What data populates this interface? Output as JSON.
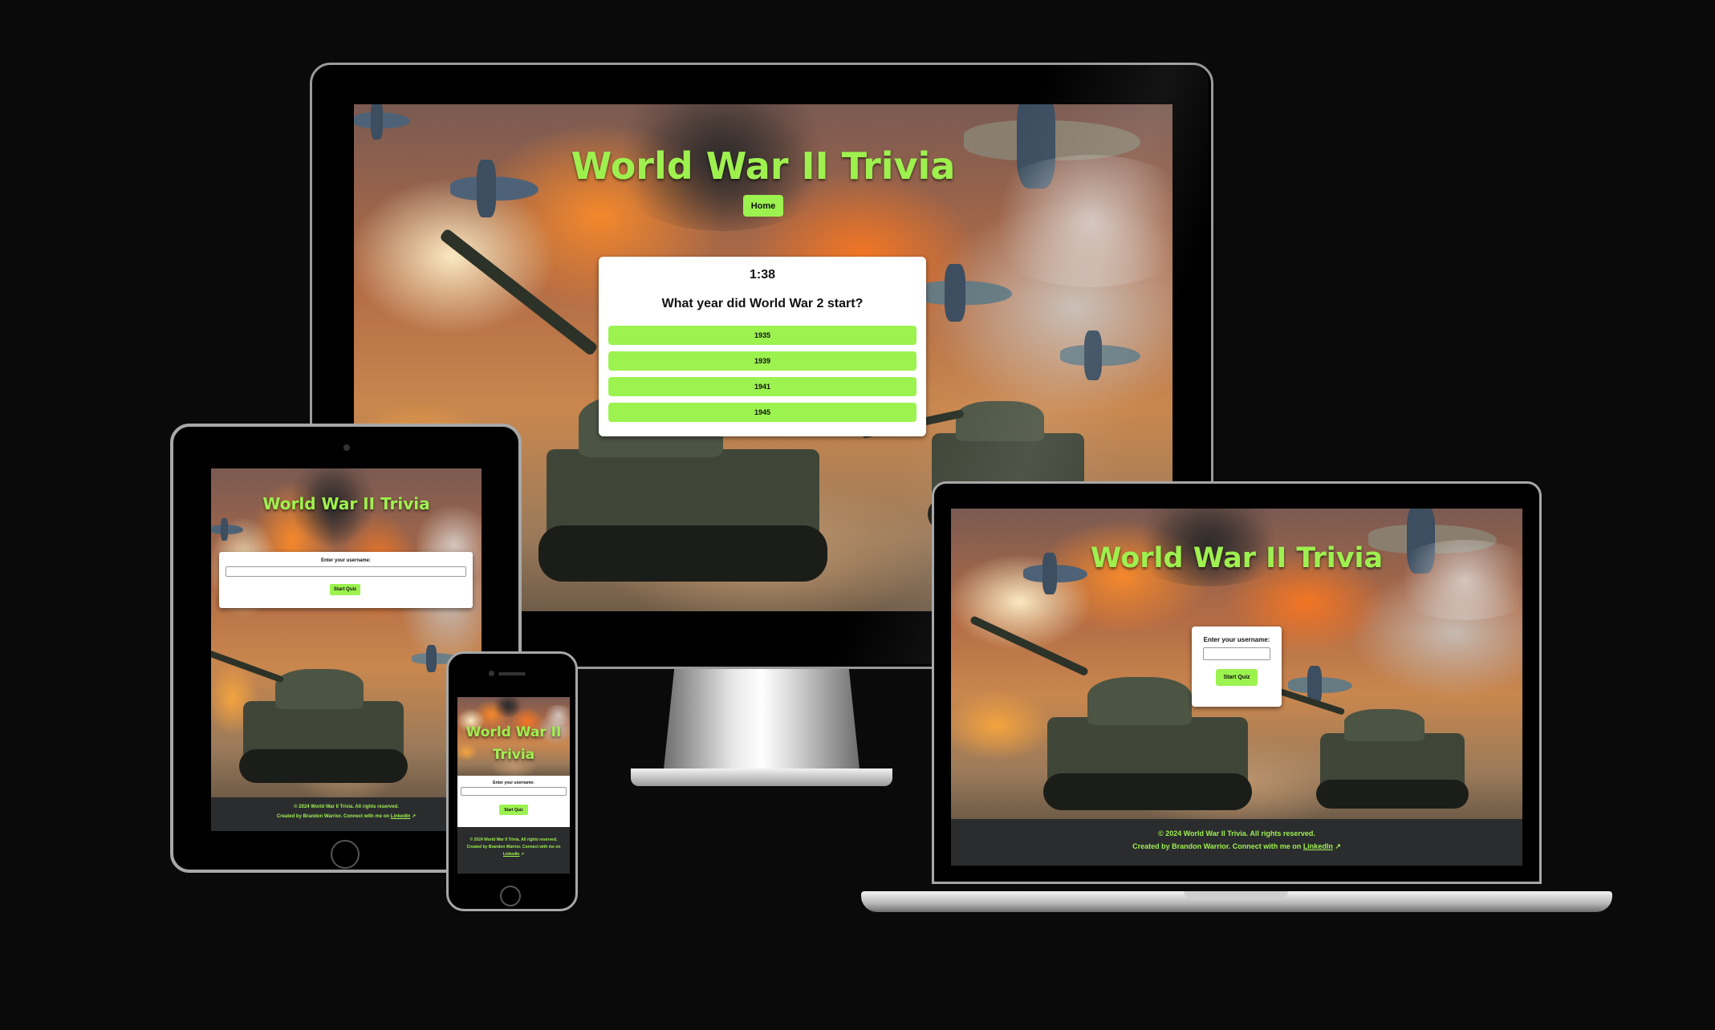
{
  "app": {
    "title": "World War II Trivia",
    "accent_color": "#9cf24f",
    "background_color": "#0a0a0a"
  },
  "desktop": {
    "nav": {
      "home_label": "Home"
    },
    "quiz": {
      "timer": "1:38",
      "question": "What year did World War 2 start?",
      "answers": [
        "1935",
        "1939",
        "1941",
        "1945"
      ]
    }
  },
  "start_form": {
    "username_label": "Enter your username:",
    "username_value": "",
    "start_label": "Start Quiz"
  },
  "footer": {
    "copyright": "© 2024 World War II Trivia. All rights reserved.",
    "credit_prefix": "Created by Brandon Warrior. Connect with me on",
    "linkedin_label": "LinkedIn",
    "linkedin_icon": "external-link-icon"
  },
  "mobile": {
    "title_line1": "World War II",
    "title_line2": "Trivia"
  }
}
